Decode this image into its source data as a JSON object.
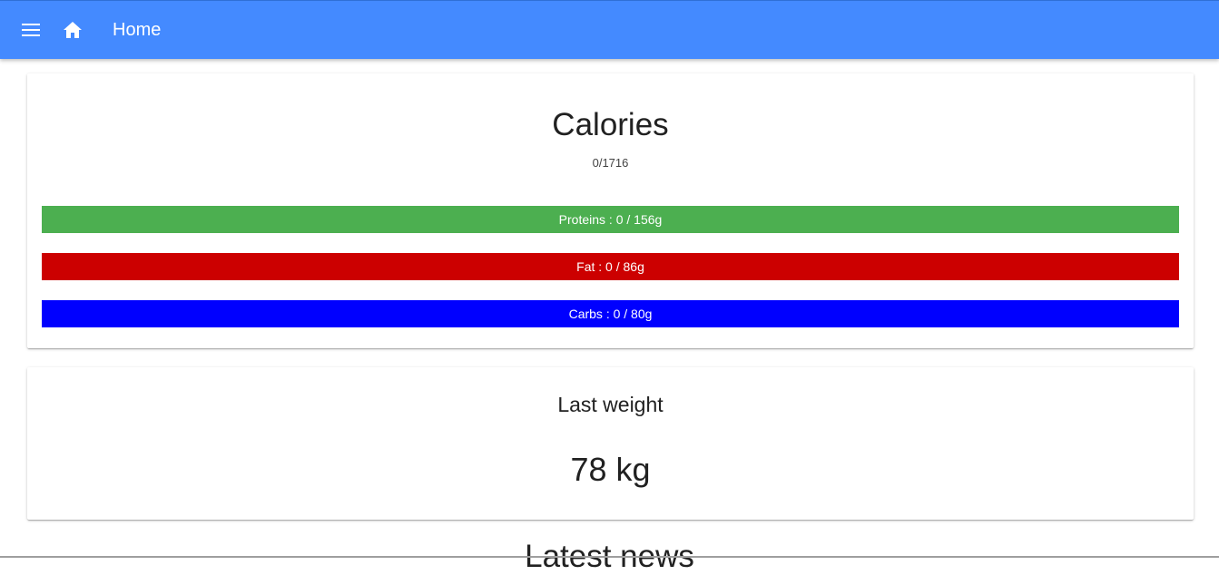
{
  "app_bar": {
    "title": "Home",
    "menu_icon": "menu-icon",
    "home_icon": "home-icon",
    "color": "#448aff"
  },
  "calories": {
    "title": "Calories",
    "value": "0/1716",
    "macros": [
      {
        "name": "proteins",
        "label": "Proteins : 0 / 156g",
        "color": "#4caf50",
        "progress": 0
      },
      {
        "name": "fat",
        "label": "Fat : 0 / 86g",
        "color": "#cc0000",
        "progress": 0
      },
      {
        "name": "carbs",
        "label": "Carbs : 0 / 80g",
        "color": "#0000ff",
        "progress": 0
      }
    ]
  },
  "weight": {
    "title": "Last weight",
    "value": "78 kg"
  },
  "news": {
    "title": "Latest news"
  }
}
